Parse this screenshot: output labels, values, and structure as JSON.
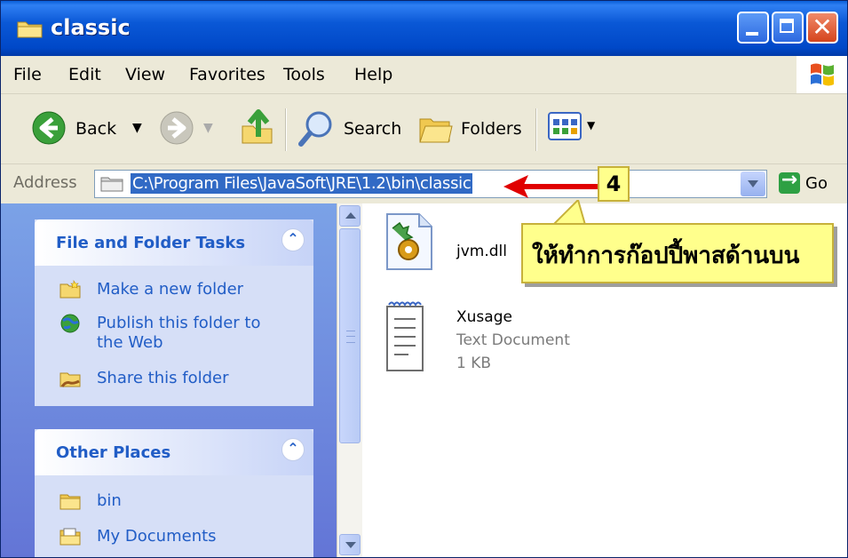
{
  "window": {
    "title": "classic"
  },
  "menubar": {
    "items": [
      "File",
      "Edit",
      "View",
      "Favorites",
      "Tools",
      "Help"
    ]
  },
  "toolbar": {
    "back_label": "Back",
    "search_label": "Search",
    "folders_label": "Folders"
  },
  "addressbar": {
    "label": "Address",
    "path": "C:\\Program Files\\JavaSoft\\JRE\\1.2\\bin\\classic",
    "go_label": "Go"
  },
  "tasks": {
    "file_folder": {
      "title": "File and Folder Tasks",
      "items": [
        "Make a new folder",
        "Publish this folder to the Web",
        "Share this folder"
      ]
    },
    "other_places": {
      "title": "Other Places",
      "items": [
        "bin",
        "My Documents"
      ]
    }
  },
  "files": [
    {
      "name": "jvm.dll"
    },
    {
      "name": "Xusage",
      "type": "Text Document",
      "size": "1 KB"
    }
  ],
  "annotation": {
    "step": "4",
    "note": "ให้ทำการก๊อปปี้พาสด้านบน",
    "arrow_color": "#e00000",
    "callout_color": "#ffff8c"
  },
  "colors": {
    "titlebar": "#0a58d6",
    "task_link": "#215dc6",
    "selection": "#316ac5"
  }
}
